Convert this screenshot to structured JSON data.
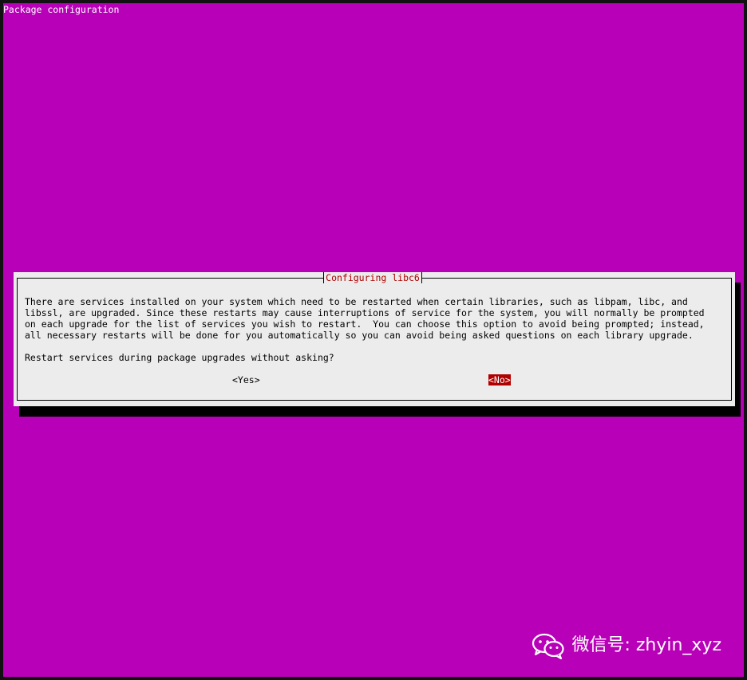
{
  "background": {
    "title": "Package configuration"
  },
  "dialog": {
    "title": "Configuring libc6",
    "body_lines": [
      "There are services installed on your system which need to be restarted when certain libraries, such as libpam, libc, and",
      "libssl, are upgraded. Since these restarts may cause interruptions of service for the system, you will normally be prompted",
      "on each upgrade for the list of services you wish to restart.  You can choose this option to avoid being prompted; instead,",
      "all necessary restarts will be done for you automatically so you can avoid being asked questions on each library upgrade."
    ],
    "question": "Restart services during package upgrades without asking?",
    "buttons": {
      "yes": "<Yes>",
      "no": "<No>"
    }
  },
  "watermark": {
    "text": "微信号: zhyin_xyz",
    "icon": "wechat-icon"
  },
  "colors": {
    "background": "#b900b9",
    "dialog": "#ececec",
    "accent": "#b00000"
  }
}
